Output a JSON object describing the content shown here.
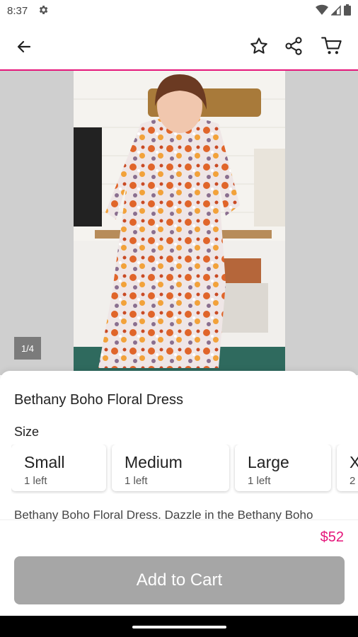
{
  "status_bar": {
    "time": "8:37"
  },
  "gallery": {
    "counter": "1/4"
  },
  "product": {
    "title": "Bethany Boho Floral Dress",
    "size_label": "Size",
    "sizes": [
      {
        "name": "Small",
        "stock": "1 left"
      },
      {
        "name": "Medium",
        "stock": "1 left"
      },
      {
        "name": "Large",
        "stock": "1 left"
      },
      {
        "name": "X",
        "stock": "2"
      }
    ],
    "description": "Bethany Boho Floral Dress. Dazzle in the Bethany Boho",
    "price": "$52"
  },
  "cart_button": {
    "label": "Add to Cart"
  },
  "colors": {
    "accent": "#e5157a",
    "button_disabled": "#a6a6a6"
  },
  "icons": [
    "gear-icon",
    "wifi-icon",
    "signal-icon",
    "battery-icon",
    "back-arrow-icon",
    "star-icon",
    "share-icon",
    "cart-icon"
  ]
}
